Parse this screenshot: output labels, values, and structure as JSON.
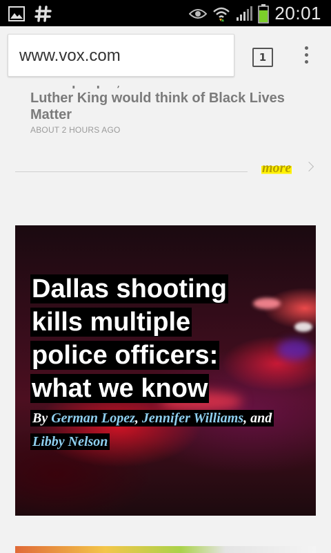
{
  "status_bar": {
    "time": "20:01",
    "icons": [
      "image-icon",
      "hashtag-icon",
      "eye-icon",
      "wifi-icon",
      "signal-icon",
      "battery-icon"
    ]
  },
  "browser": {
    "url": "www.vox.com",
    "tab_count": "1"
  },
  "previous_article": {
    "title": "White people, don't tell me what Martin Luther King would think of Black Lives Matter",
    "time": "ABOUT 2 HOURS AGO"
  },
  "more_link": "more",
  "hero": {
    "title": "Dallas shooting kills multiple police officers: what we know",
    "byline_prefix": "By ",
    "authors": [
      "German Lopez",
      "Jennifer Williams",
      "Libby Nelson"
    ],
    "sep1": ", ",
    "sep2": ",",
    "and_text": "and "
  },
  "colors": {
    "highlight": "#fff200",
    "author_link": "#8fd0f0",
    "status_bg": "#000000"
  }
}
